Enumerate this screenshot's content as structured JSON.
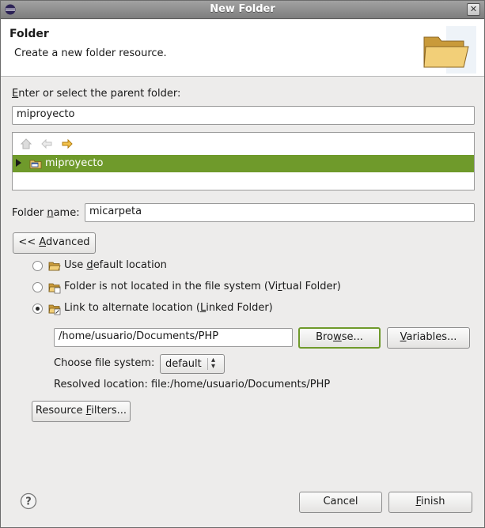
{
  "window": {
    "title": "New Folder",
    "close_symbol": "✕"
  },
  "header": {
    "title": "Folder",
    "description": "Create a new folder resource."
  },
  "parent": {
    "label_prefix": "",
    "label_mnemonic": "E",
    "label_rest": "nter or select the parent folder:",
    "value": "miproyecto"
  },
  "tree": {
    "items": [
      {
        "label": "miproyecto",
        "selected": true
      }
    ]
  },
  "folder_name": {
    "label_prefix": "Folder ",
    "label_mnemonic": "n",
    "label_rest": "ame:",
    "value": "micarpeta"
  },
  "advanced_button": {
    "prefix": "<< ",
    "mnemonic": "A",
    "rest": "dvanced"
  },
  "location_options": [
    {
      "prefix": "Use ",
      "mnemonic": "d",
      "rest": "efault location",
      "checked": false
    },
    {
      "prefix": "Folder is not located in the file system (Vi",
      "mnemonic": "r",
      "rest": "tual Folder)",
      "checked": false
    },
    {
      "prefix": "Link to alternate location (",
      "mnemonic": "L",
      "rest": "inked Folder)",
      "checked": true
    }
  ],
  "link": {
    "path": "/home/usuario/Documents/PHP",
    "browse": {
      "prefix": "Bro",
      "mnemonic": "w",
      "rest": "se..."
    },
    "variables": {
      "prefix": "",
      "mnemonic": "V",
      "rest": "ariables..."
    },
    "file_system_label": "Choose file system:",
    "file_system_value": "default",
    "resolved_label": "Resolved location:",
    "resolved_value": "file:/home/usuario/Documents/PHP"
  },
  "resource_filters": {
    "prefix": "Resource ",
    "mnemonic": "F",
    "rest": "ilters..."
  },
  "footer": {
    "cancel": "Cancel",
    "finish": {
      "prefix": "",
      "mnemonic": "F",
      "rest": "inish"
    }
  },
  "colors": {
    "selection": "#6f9a2b",
    "default_button_border": "#6f9a2b"
  }
}
